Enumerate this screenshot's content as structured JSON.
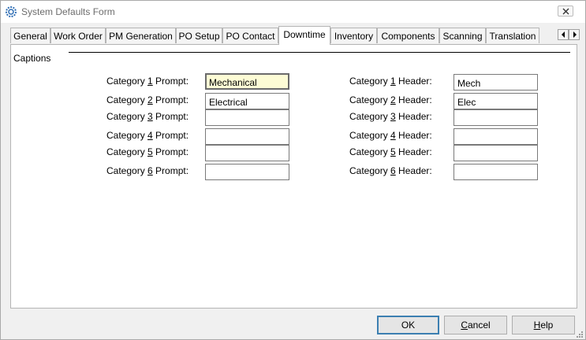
{
  "window": {
    "title": "System Defaults Form"
  },
  "tabs": [
    {
      "label": "General",
      "active": false
    },
    {
      "label": "Work Order",
      "active": false
    },
    {
      "label": "PM Generation",
      "active": false
    },
    {
      "label": "PO Setup",
      "active": false
    },
    {
      "label": "PO Contact",
      "active": false
    },
    {
      "label": "Downtime",
      "active": true
    },
    {
      "label": "Inventory",
      "active": false
    },
    {
      "label": "Components",
      "active": false
    },
    {
      "label": "Scanning",
      "active": false
    },
    {
      "label": "Translation",
      "active": false
    }
  ],
  "captions": {
    "group_title": "Captions",
    "rows": [
      {
        "prompt_pre": "Category ",
        "num": "1",
        "prompt_post": " Prompt:",
        "prompt_value": "Mechanical",
        "header_pre": "Category ",
        "header_post": " Header:",
        "header_value": "Mech"
      },
      {
        "prompt_pre": "Category ",
        "num": "2",
        "prompt_post": " Prompt:",
        "prompt_value": "Electrical",
        "header_pre": "Category ",
        "header_post": " Header:",
        "header_value": "Elec"
      },
      {
        "prompt_pre": "Category ",
        "num": "3",
        "prompt_post": " Prompt:",
        "prompt_value": "",
        "header_pre": "Category ",
        "header_post": " Header:",
        "header_value": ""
      },
      {
        "prompt_pre": "Category ",
        "num": "4",
        "prompt_post": " Prompt:",
        "prompt_value": "",
        "header_pre": "Category ",
        "header_post": " Header:",
        "header_value": ""
      },
      {
        "prompt_pre": "Category ",
        "num": "5",
        "prompt_post": " Prompt:",
        "prompt_value": "",
        "header_pre": "Category ",
        "header_post": " Header:",
        "header_value": ""
      },
      {
        "prompt_pre": "Category ",
        "num": "6",
        "prompt_post": " Prompt:",
        "prompt_value": "",
        "header_pre": "Category ",
        "header_post": " Header:",
        "header_value": ""
      }
    ]
  },
  "buttons": {
    "ok": "OK",
    "cancel_pre": "",
    "cancel_key": "C",
    "cancel_post": "ancel",
    "help_pre": "",
    "help_key": "H",
    "help_post": "elp"
  },
  "colors": {
    "focused_field": "#fdfcd5",
    "default_button_border": "#3c7fb1"
  }
}
